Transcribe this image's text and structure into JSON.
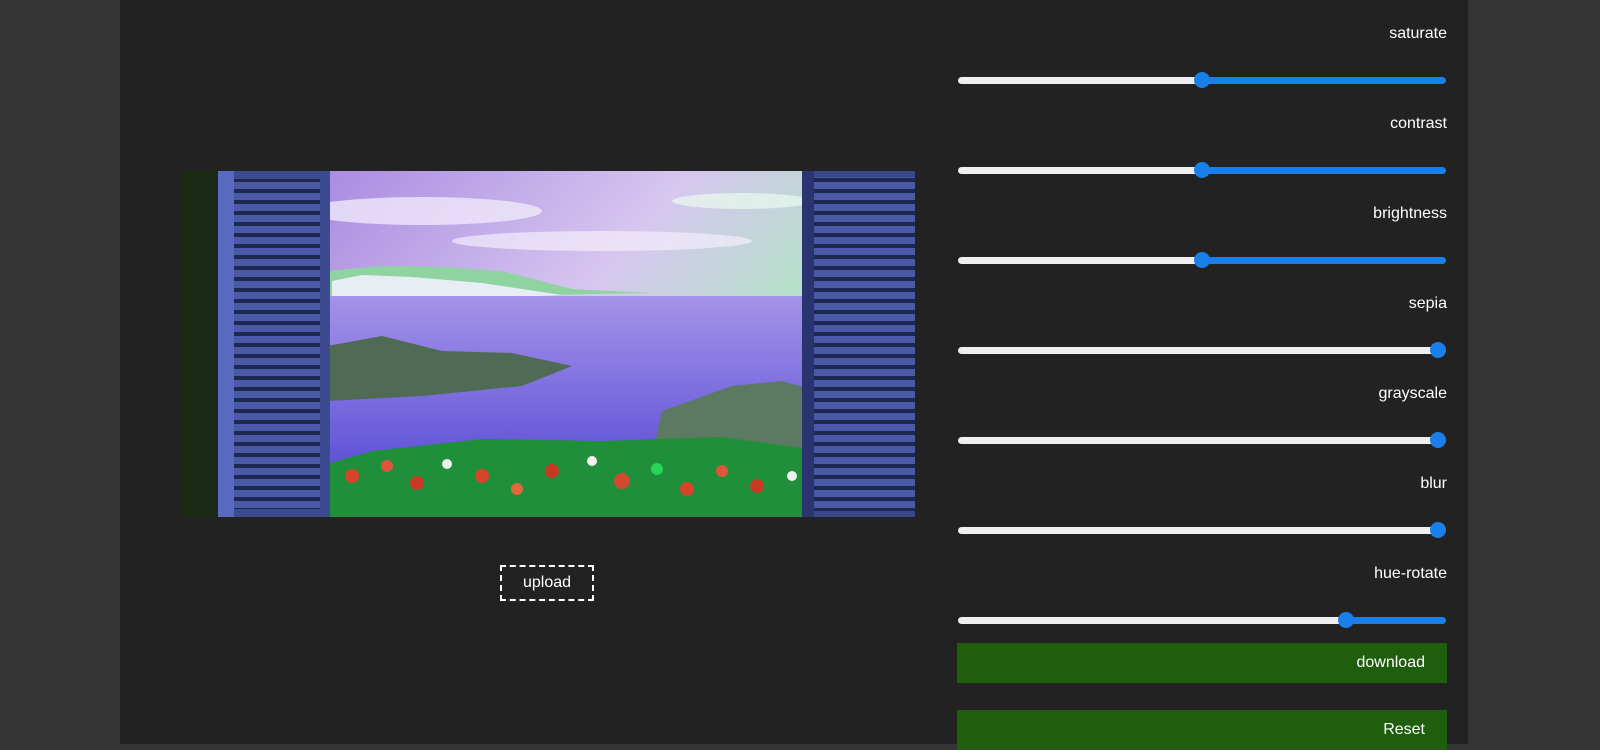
{
  "upload_label": "upload",
  "preview": {
    "image_description_icon": "window-sea-view-image"
  },
  "controls": [
    {
      "label": "saturate",
      "value_fraction": 0.5
    },
    {
      "label": "contrast",
      "value_fraction": 0.5
    },
    {
      "label": "brightness",
      "value_fraction": 0.5
    },
    {
      "label": "sepia",
      "value_fraction": 1.0
    },
    {
      "label": "grayscale",
      "value_fraction": 1.0
    },
    {
      "label": "blur",
      "value_fraction": 1.0
    },
    {
      "label": "hue-rotate",
      "value_fraction": 0.795
    }
  ],
  "buttons": {
    "download_label": "download",
    "reset_label": "Reset"
  },
  "colors": {
    "page_bg": "#343434",
    "panel_bg": "#222222",
    "accent": "#1a7fe8",
    "button_bg": "#1f5e0c"
  }
}
